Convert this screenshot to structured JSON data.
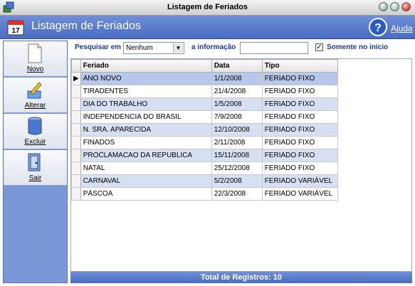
{
  "window": {
    "title": "Listagem de Feriados"
  },
  "header": {
    "title": "Listagem de Feriados",
    "help_label": "Ajuda"
  },
  "sidebar": {
    "buttons": [
      {
        "label": "Novo",
        "icon": "new-document-icon"
      },
      {
        "label": "Alterar",
        "icon": "edit-pencil-icon"
      },
      {
        "label": "Excluir",
        "icon": "trash-can-icon"
      },
      {
        "label": "Sair",
        "icon": "exit-door-icon"
      }
    ]
  },
  "search": {
    "label": "Pesquisar em",
    "field_value": "Nenhum",
    "info_label": "a informação",
    "info_value": "",
    "only_start_label": "Somente no início",
    "only_start_checked": true
  },
  "grid": {
    "columns": [
      "Feriado",
      "Data",
      "Tipo"
    ],
    "rows": [
      [
        "ANO NOVO",
        "1/1/2008",
        "FERIADO FIXO"
      ],
      [
        "TIRADENTES",
        "21/4/2008",
        "FERIADO FIXO"
      ],
      [
        "DIA DO TRABALHO",
        "1/5/2008",
        "FERIADO FIXO"
      ],
      [
        "INDEPENDENCIA DO BRASIL",
        "7/9/2008",
        "FERIADO FIXO"
      ],
      [
        "N. SRA. APARECIDA",
        "12/10/2008",
        "FERIADO FIXO"
      ],
      [
        "FINADOS",
        "2/11/2008",
        "FERIADO FIXO"
      ],
      [
        "PROCLAMACAO DA REPUBLICA",
        "15/11/2008",
        "FERIADO FIXO"
      ],
      [
        "NATAL",
        "25/12/2008",
        "FERIADO FIXO"
      ],
      [
        "CARNAVAL",
        "5/2/2008",
        "FERIADO VARIÁVEL"
      ],
      [
        "PÁSCOA",
        "22/3/2008",
        "FERIADO VARIÁVEL"
      ]
    ],
    "selected_row": 0
  },
  "footer": {
    "text": "Total de Registros: 10"
  },
  "colors": {
    "accent": "#5a7acb",
    "row_alt": "#d7e0f3",
    "label_blue": "#1e3a9a"
  }
}
